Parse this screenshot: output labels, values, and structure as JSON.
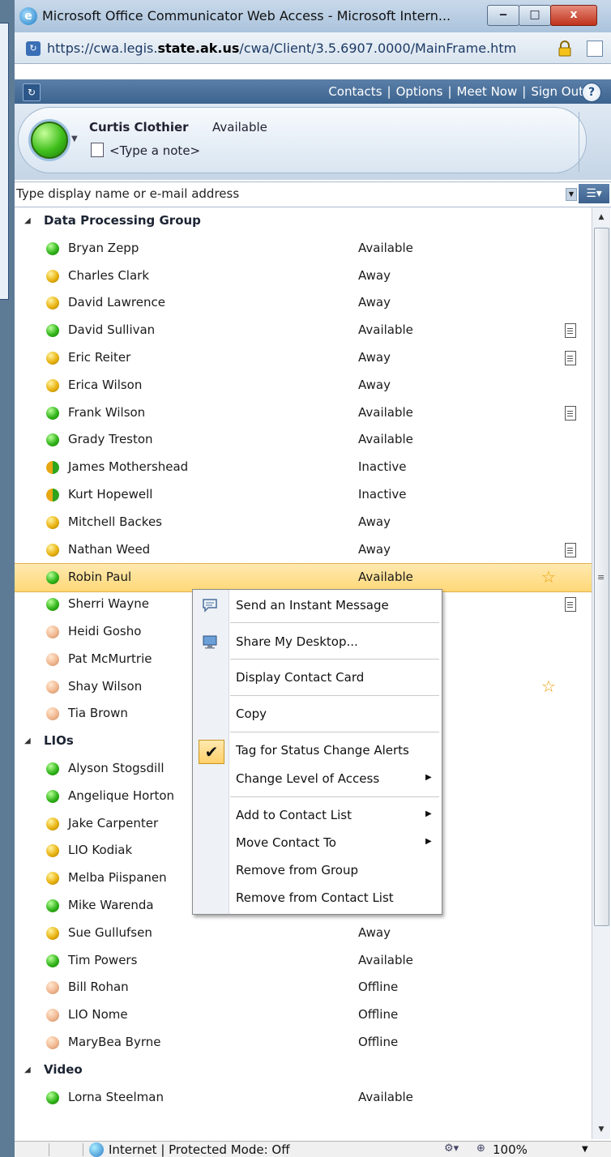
{
  "window": {
    "title": "Microsoft Office Communicator Web Access - Microsoft Intern...",
    "controls": {
      "minimize": "‒",
      "maximize": "□",
      "close": "x"
    }
  },
  "address": {
    "url_prefix": "https://cwa.legis.",
    "url_bold": "state.ak.us",
    "url_suffix": "/cwa/Client/3.5.6907.0000/MainFrame.htm"
  },
  "nav": {
    "contacts": "Contacts",
    "options": "Options",
    "meet_now": "Meet Now",
    "sign_out": "Sign Out",
    "separator": "|",
    "help": "?"
  },
  "profile": {
    "name": "Curtis Clothier",
    "status": "Available",
    "note_placeholder": "<Type a note>"
  },
  "search": {
    "placeholder": "Type display name or e-mail address"
  },
  "groups": [
    {
      "name": "Data Processing Group",
      "contacts": [
        {
          "name": "Bryan Zepp",
          "status": "Available"
        },
        {
          "name": "Charles Clark",
          "status": "Away"
        },
        {
          "name": "David Lawrence",
          "status": "Away"
        },
        {
          "name": "David Sullivan",
          "status": "Available"
        },
        {
          "name": "Eric Reiter",
          "status": "Away"
        },
        {
          "name": "Erica Wilson",
          "status": "Away"
        },
        {
          "name": "Frank Wilson",
          "status": "Available"
        },
        {
          "name": "Grady Treston",
          "status": "Available"
        },
        {
          "name": "James Mothershead",
          "status": "Inactive"
        },
        {
          "name": "Kurt Hopewell",
          "status": "Inactive"
        },
        {
          "name": "Mitchell Backes",
          "status": "Away"
        },
        {
          "name": "Nathan Weed",
          "status": "Away"
        },
        {
          "name": "Robin Paul",
          "status": "Available"
        },
        {
          "name": "Sherri Wayne",
          "status": ""
        },
        {
          "name": "Heidi Gosho",
          "status": ""
        },
        {
          "name": "Pat McMurtrie",
          "status": ""
        },
        {
          "name": "Shay Wilson",
          "status": ""
        },
        {
          "name": "Tia Brown",
          "status": ""
        }
      ]
    },
    {
      "name": "LIOs",
      "contacts": [
        {
          "name": "Alyson Stogsdill",
          "status": ""
        },
        {
          "name": "Angelique Horton",
          "status": ""
        },
        {
          "name": "Jake Carpenter",
          "status": ""
        },
        {
          "name": "LIO Kodiak",
          "status": ""
        },
        {
          "name": "Melba Piispanen",
          "status": ""
        },
        {
          "name": "Mike Warenda",
          "status": "Available"
        },
        {
          "name": "Sue Gullufsen",
          "status": "Away"
        },
        {
          "name": "Tim Powers",
          "status": "Available"
        },
        {
          "name": "Bill Rohan",
          "status": "Offline"
        },
        {
          "name": "LIO Nome",
          "status": "Offline"
        },
        {
          "name": "MaryBea Byrne",
          "status": "Offline"
        }
      ]
    },
    {
      "name": "Video",
      "contacts": [
        {
          "name": "Lorna Steelman",
          "status": "Available"
        }
      ]
    }
  ],
  "context_menu": {
    "send_im": "Send an Instant Message",
    "share_desktop": "Share My Desktop...",
    "display_card": "Display Contact Card",
    "copy": "Copy",
    "tag_alerts": "Tag for Status Change Alerts",
    "change_access": "Change Level of Access",
    "add_to_list": "Add to Contact List",
    "move_to": "Move Contact To",
    "remove_group": "Remove from Group",
    "remove_list": "Remove from Contact List"
  },
  "statusbar": {
    "zone": "Internet | Protected Mode: Off",
    "zoom": "100%"
  },
  "colors": {
    "header_blue": "#3d648f",
    "available": "#32b51a",
    "away": "#e9b310",
    "offline": "#f1b891",
    "selected_row": "#ffd877",
    "star": "#e9a00a"
  }
}
